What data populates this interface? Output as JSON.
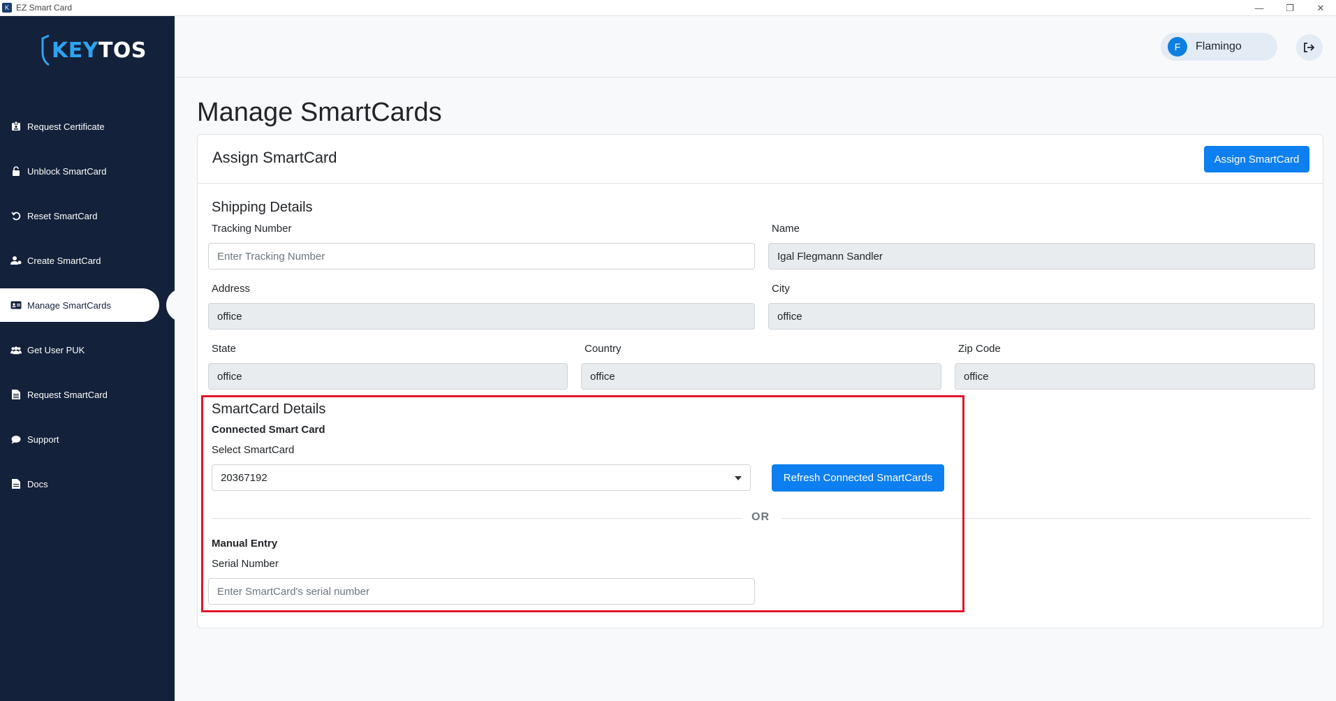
{
  "window": {
    "title": "EZ Smart Card",
    "min_glyph": "—",
    "max_glyph": "❐",
    "close_glyph": "✕"
  },
  "brand": {
    "logo_key": "KEY",
    "logo_tos": "TOS",
    "key_color": "#2ea3f2",
    "sidebar_color": "#13213a"
  },
  "sidebar": {
    "items": [
      {
        "label": "Request Certificate",
        "icon": "badge-icon"
      },
      {
        "label": "Unblock SmartCard",
        "icon": "unlock-icon"
      },
      {
        "label": "Reset SmartCard",
        "icon": "reset-icon"
      },
      {
        "label": "Create SmartCard",
        "icon": "user-gear-icon"
      },
      {
        "label": "Manage SmartCards",
        "icon": "id-card-icon",
        "active": true
      },
      {
        "label": "Get User PUK",
        "icon": "users-icon"
      },
      {
        "label": "Request SmartCard",
        "icon": "document-icon"
      },
      {
        "label": "Support",
        "icon": "chat-icon"
      },
      {
        "label": "Docs",
        "icon": "file-icon"
      }
    ]
  },
  "header": {
    "user_initial": "F",
    "user_name": "Flamingo"
  },
  "page": {
    "title": "Manage SmartCards"
  },
  "card": {
    "title": "Assign SmartCard",
    "assign_button": "Assign SmartCard",
    "shipping": {
      "section_title": "Shipping Details",
      "tracking_label": "Tracking Number",
      "tracking_placeholder": "Enter Tracking Number",
      "name_label": "Name",
      "name_value": "Igal Flegmann Sandler",
      "address_label": "Address",
      "address_value": "office",
      "city_label": "City",
      "city_value": "office",
      "state_label": "State",
      "state_value": "office",
      "country_label": "Country",
      "country_value": "office",
      "zip_label": "Zip Code",
      "zip_value": "office"
    },
    "smartcard": {
      "section_title": "SmartCard Details",
      "connected_label": "Connected Smart Card",
      "select_label": "Select SmartCard",
      "selected_value": "20367192",
      "refresh_button": "Refresh Connected SmartCards",
      "or_text": "OR",
      "manual_label": "Manual Entry",
      "serial_label": "Serial Number",
      "serial_placeholder": "Enter SmartCard's serial number"
    }
  },
  "colors": {
    "primary": "#0d7ff0",
    "highlight": "#e0162b"
  }
}
